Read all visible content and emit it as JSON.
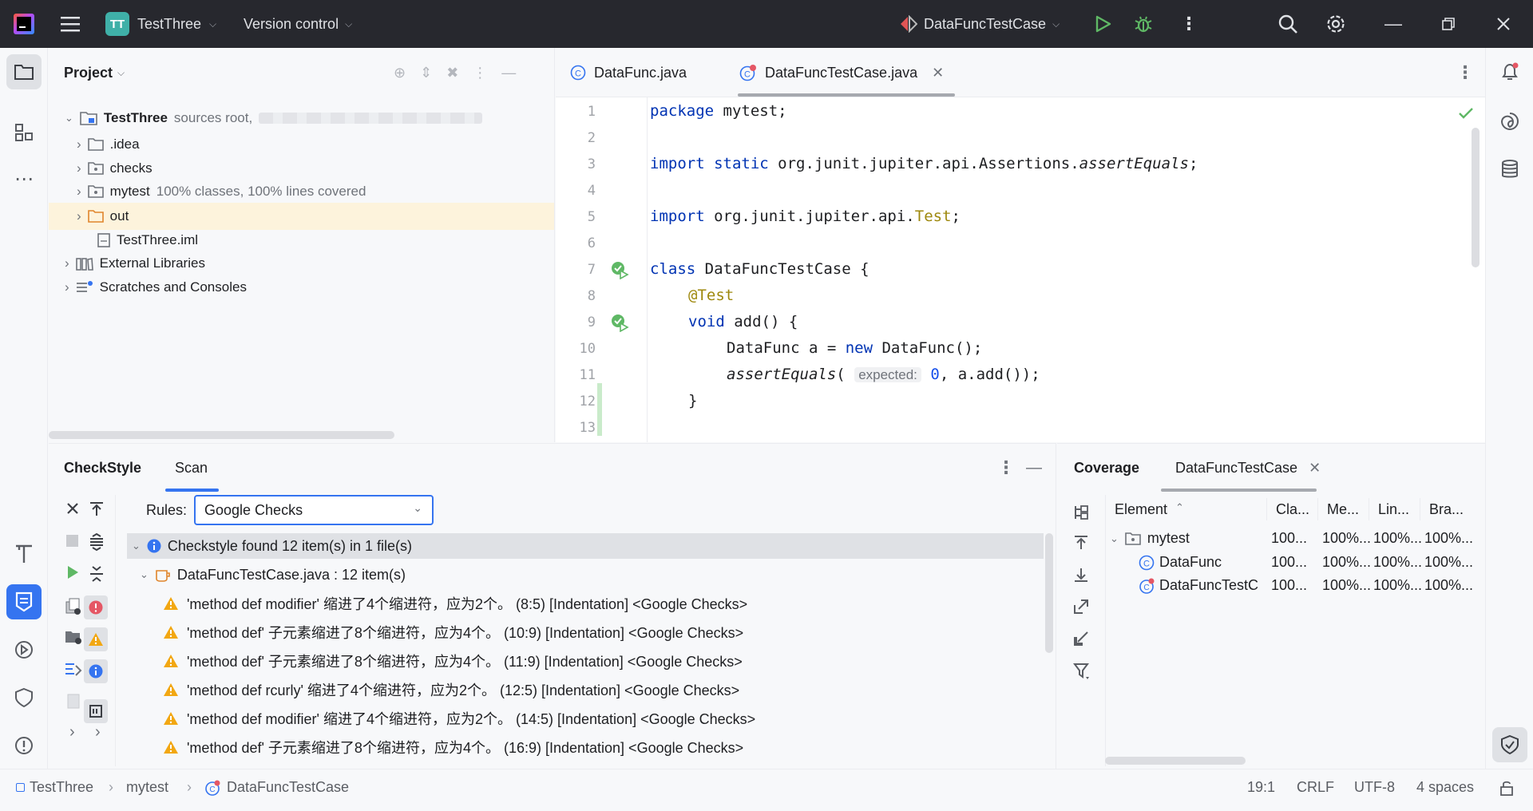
{
  "titlebar": {
    "project_badge": "TT",
    "project_name": "TestThree",
    "vcs": "Version control",
    "run_config": "DataFuncTestCase"
  },
  "project_panel": {
    "title": "Project",
    "tree": [
      {
        "label": "TestThree",
        "note": "sources root,"
      },
      {
        "label": ".idea",
        "note": ""
      },
      {
        "label": "checks",
        "note": ""
      },
      {
        "label": "mytest",
        "note": "100% classes, 100% lines covered"
      },
      {
        "label": "out",
        "note": ""
      },
      {
        "label": "TestThree.iml",
        "note": ""
      },
      {
        "label": "External Libraries",
        "note": ""
      },
      {
        "label": "Scratches and Consoles",
        "note": ""
      }
    ]
  },
  "editor": {
    "tabs": [
      {
        "label": "DataFunc.java"
      },
      {
        "label": "DataFuncTestCase.java"
      }
    ],
    "line_numbers": [
      "1",
      "2",
      "3",
      "4",
      "5",
      "6",
      "7",
      "8",
      "9",
      "10",
      "11",
      "12",
      "13"
    ],
    "code": {
      "l1a": "package",
      "l1b": " mytest;",
      "l3a": "import static",
      "l3b": " org.junit.jupiter.api.Assertions.",
      "l3c": "assertEquals",
      "l3d": ";",
      "l5a": "import",
      "l5b": " org.junit.jupiter.api.",
      "l5c": "Test",
      "l5d": ";",
      "l7a": "class",
      "l7b": " DataFuncTestCase {",
      "l8": "@Test",
      "l9a": "void",
      "l9b": " add() {",
      "l10a": "DataFunc a = ",
      "l10b": "new",
      "l10c": " DataFunc();",
      "l11a": "assertEquals",
      "l11b": "(",
      "l11hint": "expected:",
      "l11c": "0",
      ", a": "",
      "l11d": ", a.add());",
      "l12": "}"
    }
  },
  "checkstyle": {
    "tab_main": "CheckStyle",
    "tab_scan": "Scan",
    "rules_label": "Rules:",
    "rules_value": "Google Checks",
    "summary": "Checkstyle found 12 item(s) in 1 file(s)",
    "file": "DataFuncTestCase.java : 12 item(s)",
    "items": [
      "'method def modifier' 缩进了4个缩进符，应为2个。 (8:5) [Indentation] <Google Checks>",
      "'method def' 子元素缩进了8个缩进符，应为4个。 (10:9) [Indentation] <Google Checks>",
      "'method def' 子元素缩进了8个缩进符，应为4个。 (11:9) [Indentation] <Google Checks>",
      "'method def rcurly' 缩进了4个缩进符，应为2个。 (12:5) [Indentation] <Google Checks>",
      "'method def modifier' 缩进了4个缩进符，应为2个。 (14:5) [Indentation] <Google Checks>",
      "'method def' 子元素缩进了8个缩进符，应为4个。 (16:9) [Indentation] <Google Checks>"
    ]
  },
  "coverage": {
    "tab_main": "Coverage",
    "tab_run": "DataFuncTestCase",
    "columns": [
      "Element",
      "Cla...",
      "Me...",
      "Lin...",
      "Bra..."
    ],
    "rows": [
      {
        "name": "mytest",
        "c": "100...",
        "m": "100%...",
        "l": "100%...",
        "b": "100%..."
      },
      {
        "name": "DataFunc",
        "c": "100...",
        "m": "100%...",
        "l": "100%...",
        "b": "100%..."
      },
      {
        "name": "DataFuncTestC",
        "c": "100...",
        "m": "100%...",
        "l": "100%...",
        "b": "100%..."
      }
    ]
  },
  "status": {
    "crumbs": [
      "TestThree",
      "mytest",
      "DataFuncTestCase"
    ],
    "position": "19:1",
    "line_sep": "CRLF",
    "encoding": "UTF-8",
    "indent": "4 spaces"
  },
  "colors": {
    "accent": "#3574f0",
    "warning": "#f2a712",
    "green": "#5fb865",
    "selection": "#fdf3dc"
  }
}
